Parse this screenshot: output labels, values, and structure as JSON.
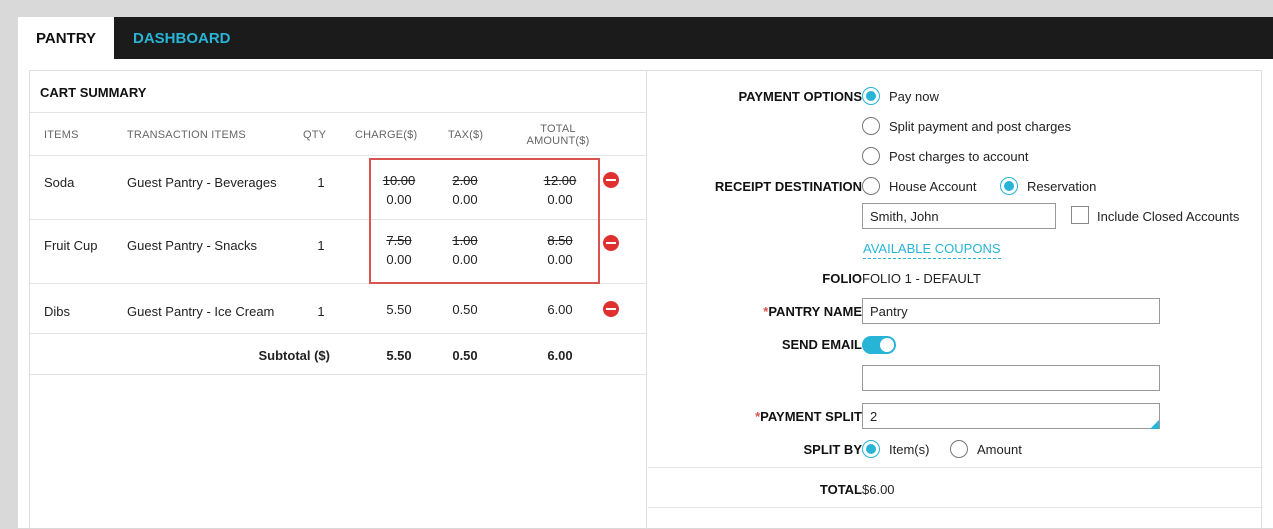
{
  "tabs": [
    {
      "label": "PANTRY"
    },
    {
      "label": "DASHBOARD"
    }
  ],
  "cart": {
    "title": "CART SUMMARY",
    "headers": {
      "items": "ITEMS",
      "transaction": "TRANSACTION ITEMS",
      "qty": "QTY",
      "charge": "CHARGE($)",
      "tax": "TAX($)",
      "total_line1": "TOTAL",
      "total_line2": "AMOUNT($)"
    },
    "rows": [
      {
        "item": "Soda",
        "transaction": "Guest Pantry - Beverages",
        "qty": "1",
        "charge_old": "10.00",
        "charge": "0.00",
        "tax_old": "2.00",
        "tax": "0.00",
        "total_old": "12.00",
        "total": "0.00"
      },
      {
        "item": "Fruit Cup",
        "transaction": "Guest Pantry - Snacks",
        "qty": "1",
        "charge_old": "7.50",
        "charge": "0.00",
        "tax_old": "1.00",
        "tax": "0.00",
        "total_old": "8.50",
        "total": "0.00"
      },
      {
        "item": "Dibs",
        "transaction": "Guest Pantry - Ice Cream",
        "qty": "1",
        "charge": "5.50",
        "tax": "0.50",
        "total": "6.00"
      }
    ],
    "subtotal": {
      "label": "Subtotal ($)",
      "charge": "5.50",
      "tax": "0.50",
      "total": "6.00"
    }
  },
  "form": {
    "payment_options_label": "PAYMENT OPTIONS",
    "payment_options": [
      "Pay now",
      "Split payment and post charges",
      "Post charges to account"
    ],
    "payment_selected": "Pay now",
    "receipt_label": "RECEIPT DESTINATION",
    "receipt_options": [
      "House Account",
      "Reservation"
    ],
    "receipt_selected": "Reservation",
    "guest_name": "Smith, John",
    "include_closed_label": "Include Closed Accounts",
    "coupons_link": "AVAILABLE COUPONS",
    "folio_label": "FOLIO",
    "folio_value": "FOLIO 1 - DEFAULT",
    "pantry_name_label": "PANTRY NAME",
    "pantry_name_value": "Pantry",
    "send_email_label": "SEND EMAIL",
    "send_email_on": true,
    "email_value": "",
    "payment_split_label": "PAYMENT SPLIT",
    "payment_split_value": "2",
    "split_by_label": "SPLIT BY",
    "split_by_options": [
      "Item(s)",
      "Amount"
    ],
    "split_by_selected": "Item(s)",
    "total_label": "TOTAL",
    "total_value": "$6.00",
    "required_mark": "*"
  },
  "colors": {
    "accent": "#27b4d6",
    "danger": "#e03131",
    "highlight_box": "#d9534f",
    "tabbar": "#1b1b1b"
  },
  "icons": {
    "remove": "minus-circle-icon",
    "radio": "radio-icon",
    "toggle": "toggle-icon"
  }
}
